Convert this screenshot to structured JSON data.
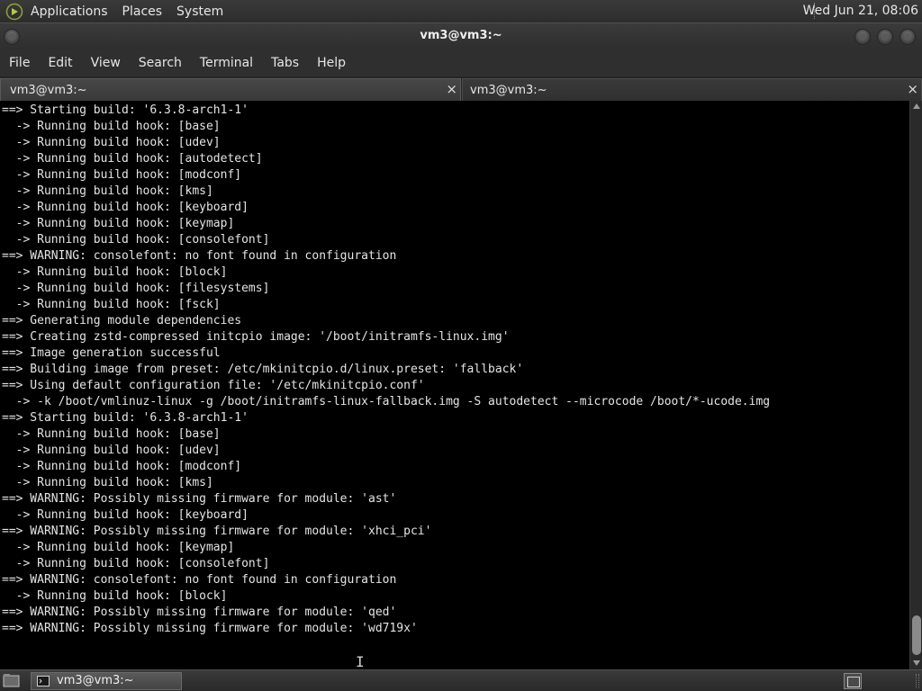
{
  "top_panel": {
    "menus": [
      "Applications",
      "Places",
      "System"
    ],
    "clock": "Wed Jun 21, 08:06"
  },
  "window": {
    "title": "vm3@vm3:~"
  },
  "menubar": {
    "items": [
      "File",
      "Edit",
      "View",
      "Search",
      "Terminal",
      "Tabs",
      "Help"
    ]
  },
  "tabs": [
    {
      "label": "vm3@vm3:~",
      "close": "×"
    },
    {
      "label": "vm3@vm3:~",
      "close": "×"
    }
  ],
  "terminal": {
    "lines": [
      "==> Starting build: '6.3.8-arch1-1'",
      "  -> Running build hook: [base]",
      "  -> Running build hook: [udev]",
      "  -> Running build hook: [autodetect]",
      "  -> Running build hook: [modconf]",
      "  -> Running build hook: [kms]",
      "  -> Running build hook: [keyboard]",
      "  -> Running build hook: [keymap]",
      "  -> Running build hook: [consolefont]",
      "==> WARNING: consolefont: no font found in configuration",
      "  -> Running build hook: [block]",
      "  -> Running build hook: [filesystems]",
      "  -> Running build hook: [fsck]",
      "==> Generating module dependencies",
      "==> Creating zstd-compressed initcpio image: '/boot/initramfs-linux.img'",
      "==> Image generation successful",
      "==> Building image from preset: /etc/mkinitcpio.d/linux.preset: 'fallback'",
      "==> Using default configuration file: '/etc/mkinitcpio.conf'",
      "  -> -k /boot/vmlinuz-linux -g /boot/initramfs-linux-fallback.img -S autodetect --microcode /boot/*-ucode.img",
      "==> Starting build: '6.3.8-arch1-1'",
      "  -> Running build hook: [base]",
      "  -> Running build hook: [udev]",
      "  -> Running build hook: [modconf]",
      "  -> Running build hook: [kms]",
      "==> WARNING: Possibly missing firmware for module: 'ast'",
      "  -> Running build hook: [keyboard]",
      "==> WARNING: Possibly missing firmware for module: 'xhci_pci'",
      "  -> Running build hook: [keymap]",
      "  -> Running build hook: [consolefont]",
      "==> WARNING: consolefont: no font found in configuration",
      "  -> Running build hook: [block]",
      "==> WARNING: Possibly missing firmware for module: 'qed'",
      "==> WARNING: Possibly missing firmware for module: 'wd719x'"
    ]
  },
  "taskbar": {
    "task_label": "vm3@vm3:~"
  },
  "icons": {
    "panel_logo": "gnome-foot-icon",
    "terminal_task": "terminal-icon",
    "show_desktop": "show-desktop-icon"
  },
  "colors": {
    "terminal_bg": "#000000",
    "terminal_fg": "#e4e4e4",
    "panel_bg": "#333333"
  }
}
